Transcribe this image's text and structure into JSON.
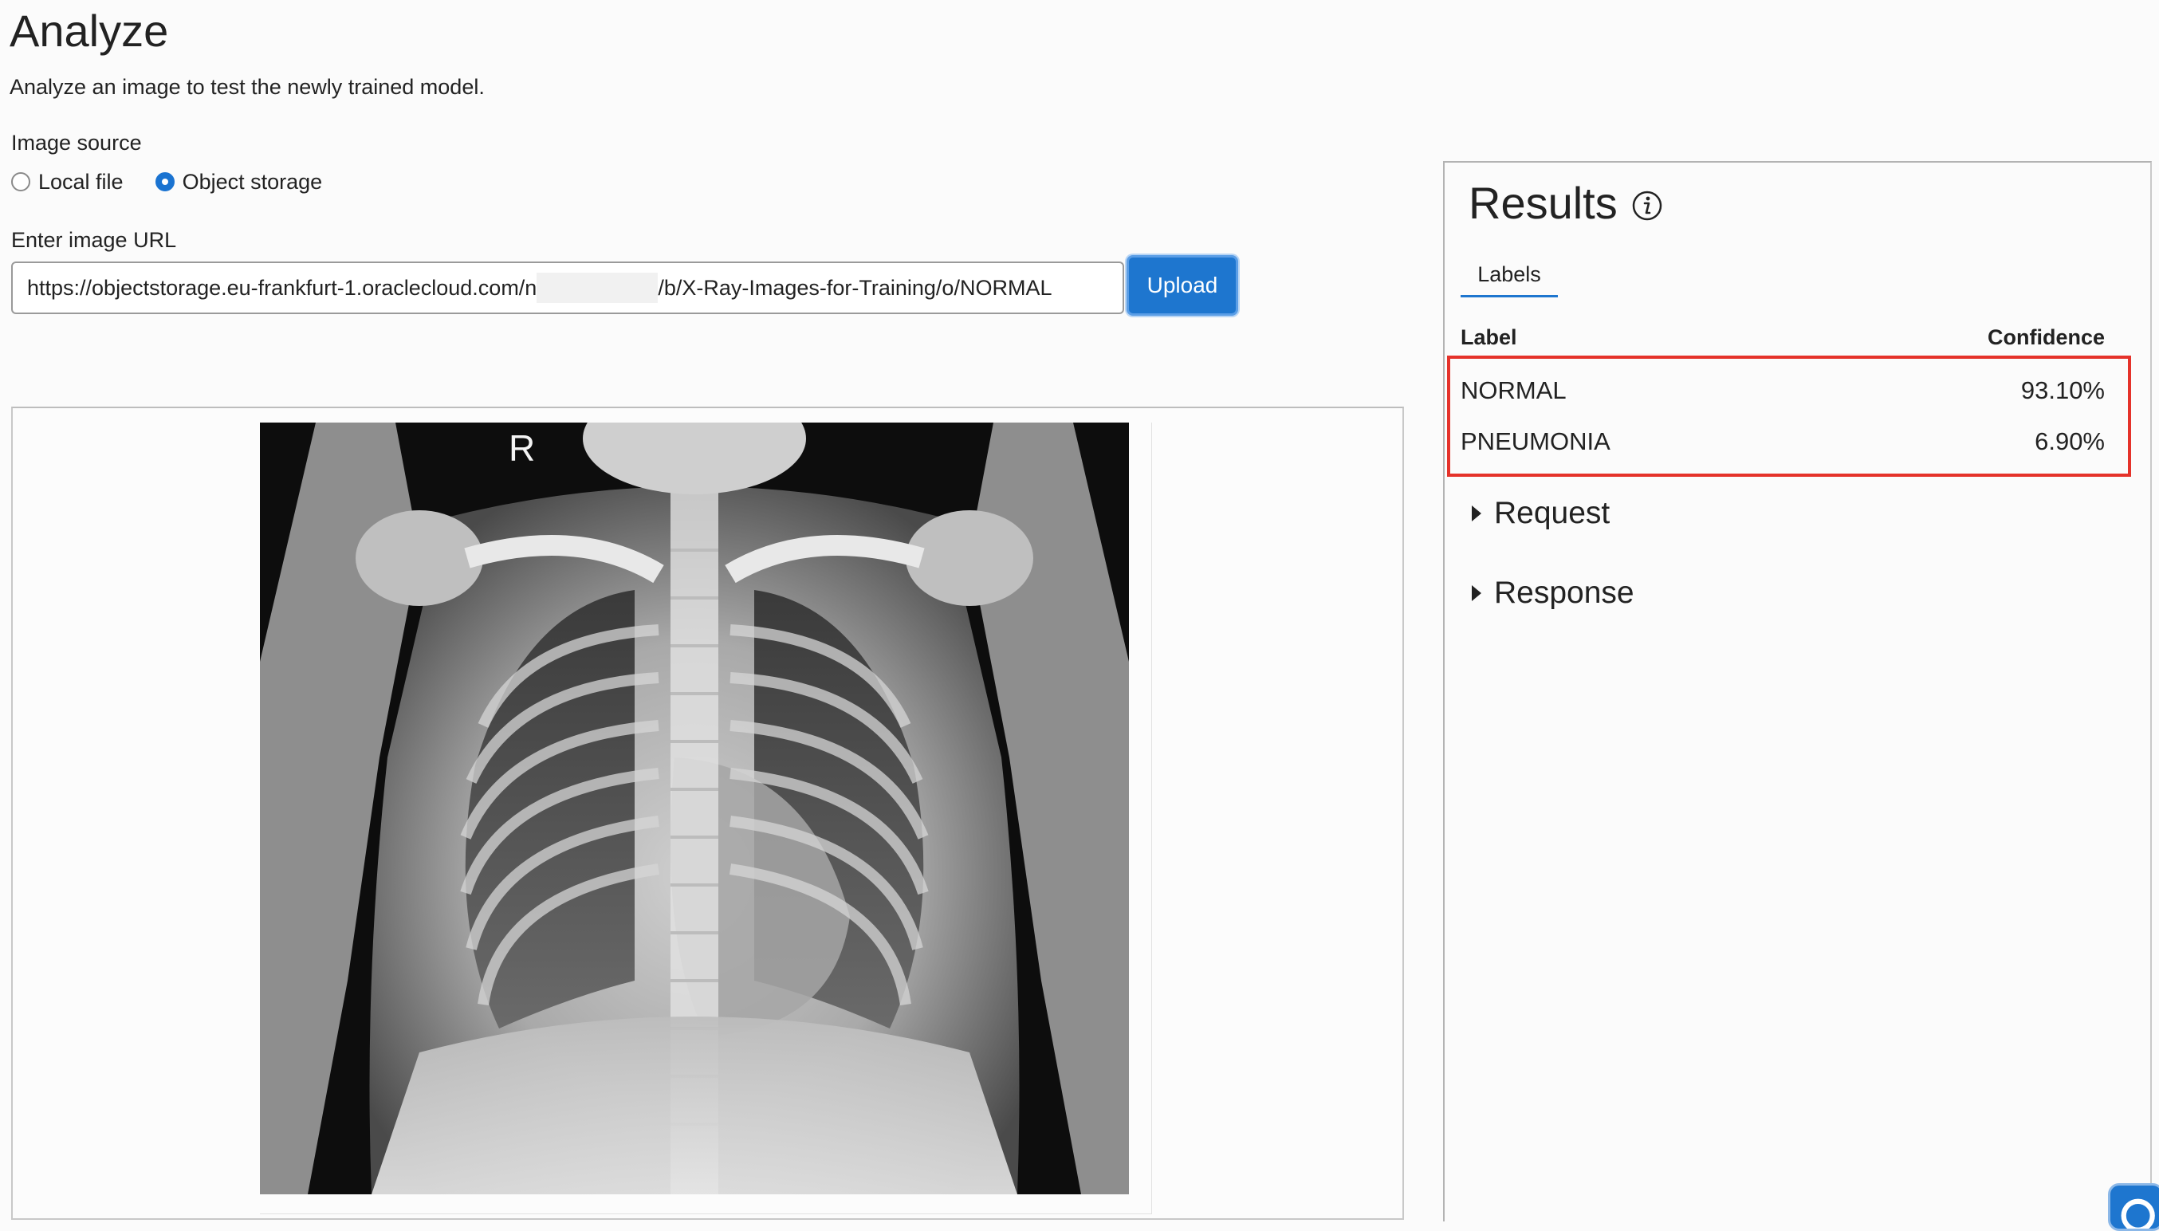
{
  "header": {
    "title": "Analyze",
    "subtitle": "Analyze an image to test the newly trained model."
  },
  "image_source": {
    "label": "Image source",
    "options": [
      {
        "label": "Local file",
        "selected": false
      },
      {
        "label": "Object storage",
        "selected": true
      }
    ]
  },
  "url_field": {
    "label": "Enter image URL",
    "value_start": "https://objectstorage.eu-frankfurt-1.oraclecloud.com/n",
    "value_end": "/b/X-Ray-Images-for-Training/o/NORMAL"
  },
  "upload_button": {
    "label": "Upload"
  },
  "image": {
    "marker": "R"
  },
  "results": {
    "title": "Results",
    "info_icon": "info-icon",
    "tabs": [
      {
        "label": "Labels",
        "active": true
      }
    ],
    "columns": {
      "label": "Label",
      "confidence": "Confidence"
    },
    "rows": [
      {
        "label": "NORMAL",
        "confidence": "93.10%"
      },
      {
        "label": "PNEUMONIA",
        "confidence": "6.90%"
      }
    ],
    "highlight_color": "#e5322a",
    "sections": [
      {
        "label": "Request",
        "expanded": false
      },
      {
        "label": "Response",
        "expanded": false
      }
    ]
  },
  "colors": {
    "accent": "#1e76cf"
  }
}
